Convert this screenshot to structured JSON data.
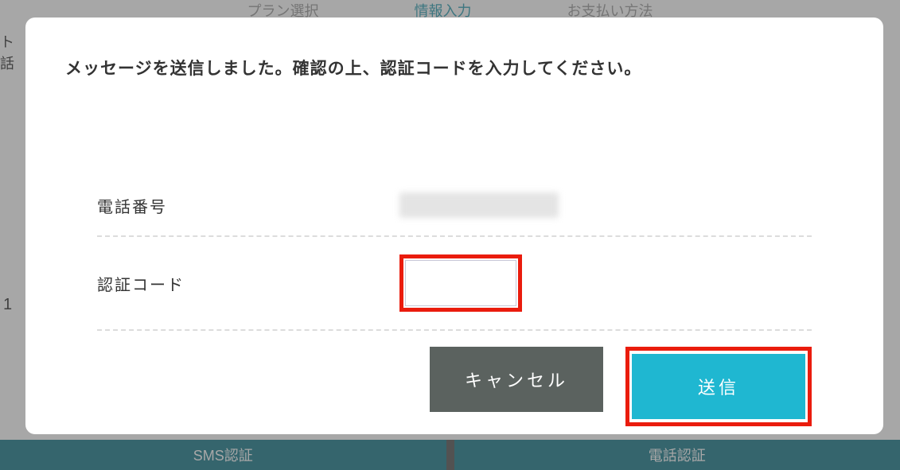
{
  "background": {
    "steps": {
      "plan": "プラン選択",
      "info": "情報入力",
      "payment": "お支払い方法"
    },
    "left_text_line1": "ト",
    "left_text_line2": "話",
    "left_num": "1",
    "bottom_left": "SMS認証",
    "bottom_right": "電話認証"
  },
  "modal": {
    "title": "メッセージを送信しました。確認の上、認証コードを入力してください。",
    "phone_label": "電話番号",
    "code_label": "認証コード",
    "cancel_label": "キャンセル",
    "submit_label": "送信"
  }
}
